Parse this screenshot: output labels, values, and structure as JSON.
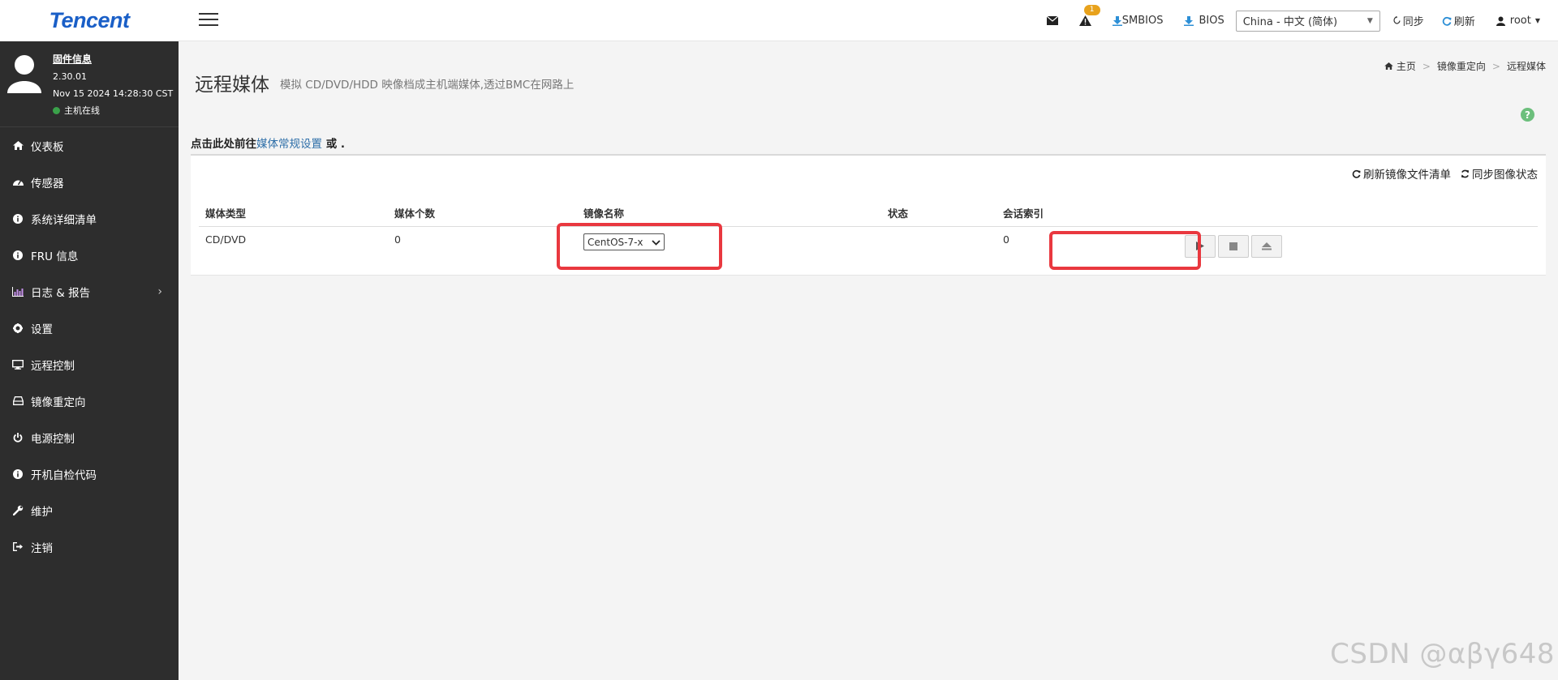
{
  "brand": {
    "logo_text": "Tencent",
    "accent": "#1a5fc7"
  },
  "header": {
    "mail_icon": "envelope-icon",
    "alert_icon": "warning-icon",
    "alert_count": "1",
    "smbios_label": "SMBIOS",
    "bios_label": "BIOS",
    "language": "China - 中文 (简体)",
    "sync_label": "同步",
    "refresh_label": "刷新",
    "user": "root"
  },
  "profile": {
    "firmware_link": "固件信息",
    "version": "2.30.01",
    "datetime": "Nov 15 2024 14:28:30 CST",
    "host_status": "主机在线",
    "status_color": "#3aa14a"
  },
  "sidebar": {
    "items": [
      {
        "label": "仪表板",
        "icon": "home-icon"
      },
      {
        "label": "传感器",
        "icon": "dashboard-icon"
      },
      {
        "label": "系统详细清单",
        "icon": "info-icon"
      },
      {
        "label": "FRU 信息",
        "icon": "info-icon"
      },
      {
        "label": "日志 & 报告",
        "icon": "bar-chart-icon"
      },
      {
        "label": "设置",
        "icon": "gear-icon"
      },
      {
        "label": "远程控制",
        "icon": "monitor-icon"
      },
      {
        "label": "镜像重定向",
        "icon": "drive-icon"
      },
      {
        "label": "电源控制",
        "icon": "power-icon"
      },
      {
        "label": "开机自检代码",
        "icon": "info-icon"
      },
      {
        "label": "维护",
        "icon": "wrench-icon"
      },
      {
        "label": "注销",
        "icon": "sign-out-icon"
      }
    ]
  },
  "page": {
    "title": "远程媒体",
    "subtitle": "模拟 CD/DVD/HDD 映像档成主机端媒体,透过BMC在网路上",
    "breadcrumb": {
      "home": "主页",
      "parent": "镜像重定向",
      "current": "远程媒体"
    },
    "notice_prefix": "点击此处前往",
    "notice_link": "媒体常规设置",
    "notice_suffix": " 或 ."
  },
  "panel": {
    "refresh_list_label": "刷新镜像文件清单",
    "sync_status_label": "同步图像状态"
  },
  "table": {
    "headers": {
      "type": "媒体类型",
      "count": "媒体个数",
      "image": "镜像名称",
      "status": "状态",
      "session": "会话索引"
    },
    "rows": [
      {
        "type": "CD/DVD",
        "count": "0",
        "image": "CentOS-7-x",
        "status": "",
        "session": "0"
      }
    ]
  },
  "watermark": "CSDN @αβγ648",
  "colors": {
    "sidebar_bg": "#2d2d2d",
    "link": "#2d6ea8",
    "highlight": "#e9383f",
    "badge": "#e8a21c"
  }
}
